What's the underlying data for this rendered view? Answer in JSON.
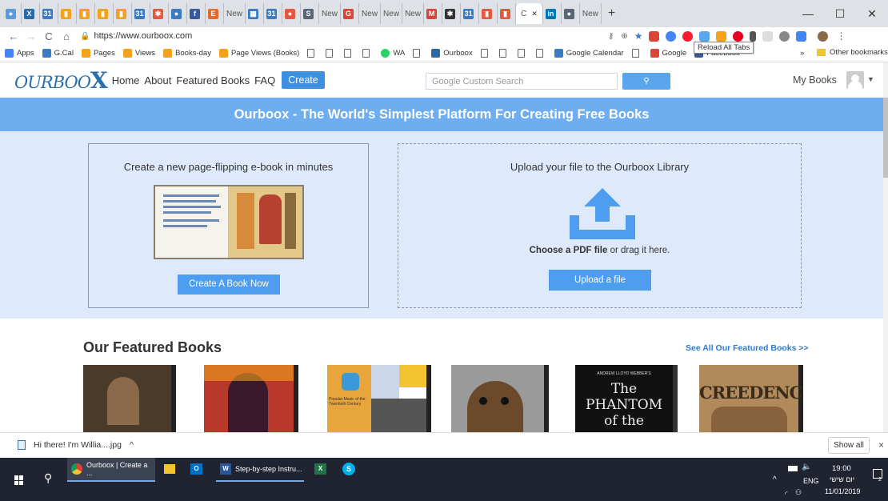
{
  "browser": {
    "tabs": [
      {
        "fav": "●",
        "color": "#5a9be0"
      },
      {
        "fav": "X",
        "color": "#2b6aa8"
      },
      {
        "fav": "31",
        "color": "#3b7bc4"
      },
      {
        "fav": "▮",
        "color": "#f4a21c"
      },
      {
        "fav": "▮",
        "color": "#f4a21c"
      },
      {
        "fav": "▮",
        "color": "#f4a21c"
      },
      {
        "fav": "▮",
        "color": "#f4a21c"
      },
      {
        "fav": "31",
        "color": "#3b7bc4"
      },
      {
        "fav": "✱",
        "color": "#e5573e"
      },
      {
        "fav": "●",
        "color": "#3b7bc4"
      },
      {
        "fav": "f",
        "color": "#3b5998"
      },
      {
        "fav": "E",
        "color": "#e56b2e"
      },
      {
        "label": "New",
        "fav": "",
        "color": "transparent"
      },
      {
        "fav": "▦",
        "color": "#3b7bc4"
      },
      {
        "fav": "31",
        "color": "#3b7bc4"
      },
      {
        "fav": "●",
        "color": "#e5573e"
      },
      {
        "fav": "S",
        "color": "#5a6675"
      },
      {
        "label": "New",
        "fav": "",
        "color": "transparent"
      },
      {
        "fav": "G",
        "color": "#db4437"
      },
      {
        "label": "New",
        "fav": "",
        "color": "transparent"
      },
      {
        "label": "New",
        "fav": "",
        "color": "transparent"
      },
      {
        "label": "New",
        "fav": "",
        "color": "transparent"
      },
      {
        "fav": "M",
        "color": "#db4437"
      },
      {
        "fav": "✱",
        "color": "#333333"
      },
      {
        "fav": "31",
        "color": "#3b7bc4"
      },
      {
        "fav": "▮",
        "color": "#e5573e"
      },
      {
        "fav": "▮",
        "color": "#e5573e"
      },
      {
        "label": "C",
        "fav": "",
        "color": "transparent",
        "active": true
      },
      {
        "fav": "in",
        "color": "#0077b5"
      },
      {
        "fav": "●",
        "color": "#5a6675"
      },
      {
        "label": "New",
        "fav": "",
        "color": "transparent"
      }
    ],
    "new_tab": "+",
    "url": "https://www.ourboox.com",
    "tooltip": "Reload All Tabs",
    "bookmarks": [
      {
        "label": "Apps",
        "icon": "apps-icon"
      },
      {
        "label": "G.Cal",
        "icon": "calendar-icon"
      },
      {
        "label": "Pages",
        "icon": "analytics-icon"
      },
      {
        "label": "Views",
        "icon": "analytics-icon"
      },
      {
        "label": "Books-day",
        "icon": "analytics-icon"
      },
      {
        "label": "Page Views (Books)",
        "icon": "analytics-icon"
      },
      {
        "label": "",
        "icon": "page-icon"
      },
      {
        "label": "",
        "icon": "page-icon"
      },
      {
        "label": "",
        "icon": "page-icon"
      },
      {
        "label": "",
        "icon": "page-icon"
      },
      {
        "label": "WA",
        "icon": "whatsapp-icon"
      },
      {
        "label": "",
        "icon": "page-icon"
      },
      {
        "label": "Ourboox",
        "icon": "ourboox-icon"
      },
      {
        "label": "",
        "icon": "page-icon"
      },
      {
        "label": "",
        "icon": "page-icon"
      },
      {
        "label": "",
        "icon": "page-icon"
      },
      {
        "label": "",
        "icon": "page-icon"
      },
      {
        "label": "Google Calendar",
        "icon": "calendar-icon"
      },
      {
        "label": "",
        "icon": "page-icon"
      },
      {
        "label": "Google",
        "icon": "google-icon"
      },
      {
        "label": "Facebook",
        "icon": "facebook-icon"
      }
    ],
    "bookmarks_more": "»",
    "other_bookmarks": "Other bookmarks"
  },
  "site": {
    "logo": "OURBOO",
    "logo_x": "X",
    "nav": [
      "Home",
      "About",
      "Featured Books",
      "FAQ"
    ],
    "create": "Create",
    "search_placeholder": "Google Custom Search",
    "search_button": "🔍",
    "my_books": "My Books",
    "banner": "Ourboox - The World's Simplest Platform For Creating Free Books",
    "left_card": {
      "title": "Create a new page-flipping e-book in minutes",
      "button": "Create A Book Now"
    },
    "right_card": {
      "title": "Upload your file to the Ourboox Library",
      "choose_bold": "Choose a PDF file",
      "choose_rest": " or drag it here.",
      "button": "Upload a file"
    },
    "featured_title": "Our Featured Books",
    "see_all": "See All Our Featured Books >>",
    "books": [
      {
        "title": "",
        "bg": "#4a3a2a"
      },
      {
        "title": "",
        "bg": "#b8382a"
      },
      {
        "title": "Popular Music of the Twentieth Century",
        "bg": "#e8a53b"
      },
      {
        "title": "",
        "bg": "#8a8a8a"
      },
      {
        "title": "The PHANTOM of the",
        "subtitle": "ANDREW LLOYD WEBBER'S",
        "bg": "#111111"
      },
      {
        "title": "CREEDENCE",
        "bg": "#b08a5a"
      }
    ]
  },
  "download": {
    "file": "Hi there! I'm Willia....jpg",
    "caret": "^",
    "show_all": "Show all",
    "close": "×"
  },
  "taskbar": {
    "chrome_label": "Ourboox | Create a ...",
    "word_label": "Step-by-step Instru...",
    "lang": "ENG",
    "time": "19:00",
    "day": "יום שישי",
    "date": "11/01/2019",
    "notif_count": "2"
  }
}
